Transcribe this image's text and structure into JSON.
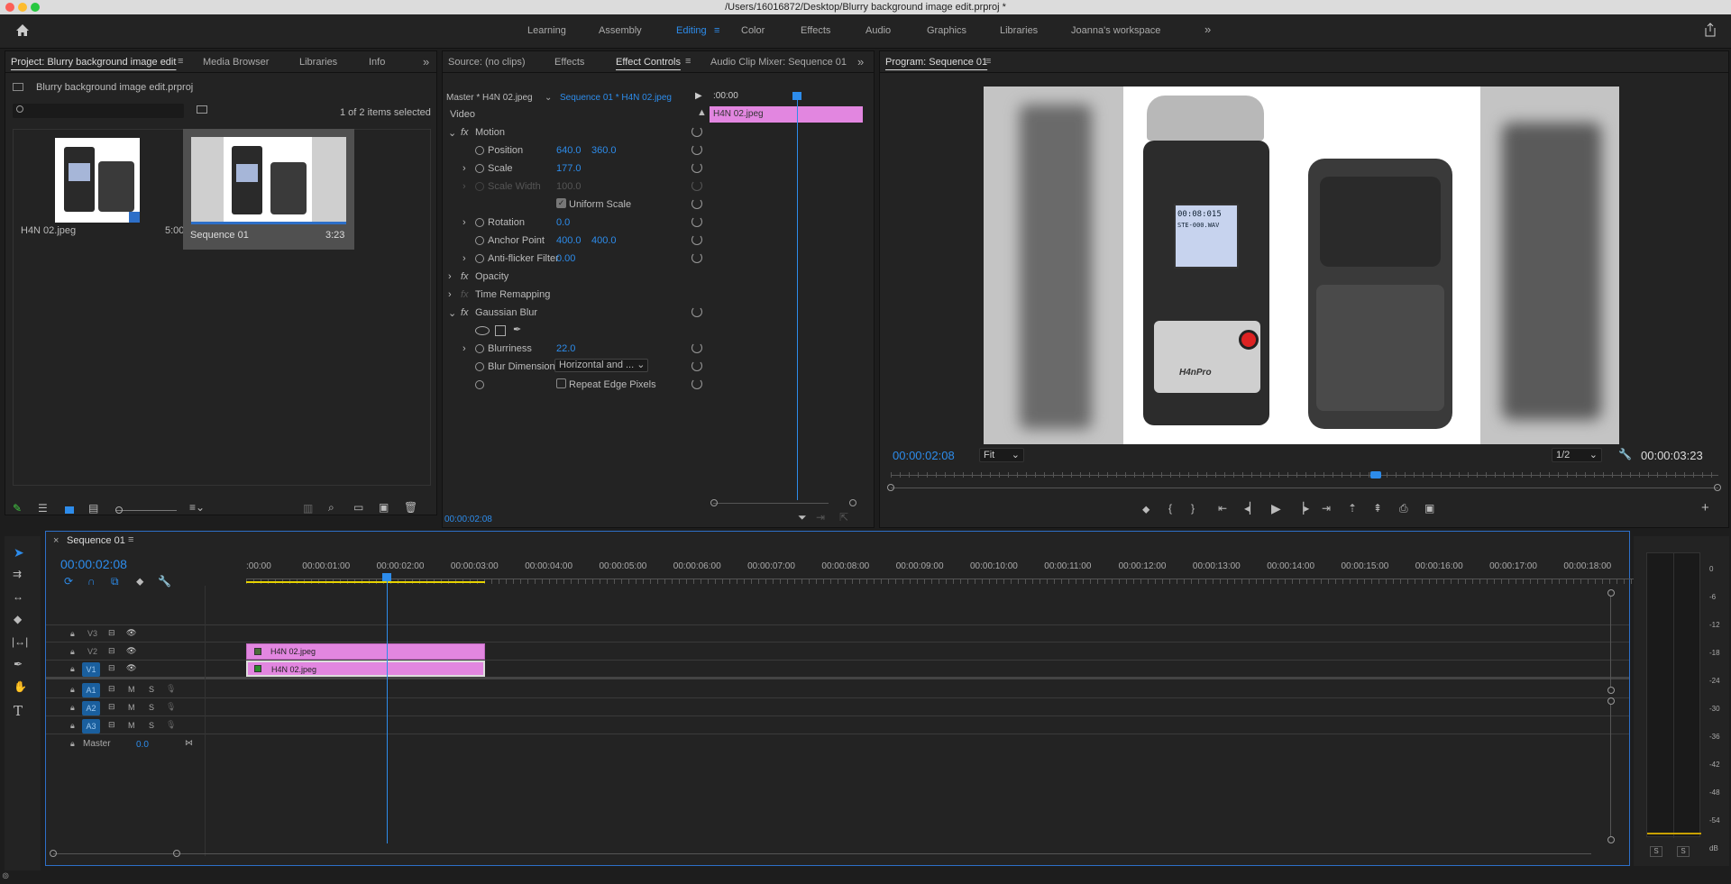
{
  "window": {
    "title": "/Users/16016872/Desktop/Blurry background image edit.prproj *"
  },
  "workspaces": [
    "Learning",
    "Assembly",
    "Editing",
    "Color",
    "Effects",
    "Audio",
    "Graphics",
    "Libraries",
    "Joanna's workspace"
  ],
  "active_workspace": "Editing",
  "project_panel": {
    "tabs": [
      "Project: Blurry background image edit",
      "Media Browser",
      "Libraries",
      "Info"
    ],
    "file": "Blurry background image edit.prproj",
    "selection": "1 of 2 items selected",
    "items": [
      {
        "name": "H4N 02.jpeg",
        "duration": "5:00"
      },
      {
        "name": "Sequence 01",
        "duration": "3:23"
      }
    ]
  },
  "effect_controls": {
    "tabs": [
      "Source: (no clips)",
      "Effects",
      "Effect Controls",
      "Audio Clip Mixer: Sequence 01"
    ],
    "master": "Master * H4N 02.jpeg",
    "sequence": "Sequence 01 * H4N 02.jpeg",
    "timecode_start": ":00:00",
    "clip_label": "H4N 02.jpeg",
    "section": "Video",
    "motion": "Motion",
    "position": "Position",
    "position_x": "640.0",
    "position_y": "360.0",
    "scale": "Scale",
    "scale_val": "177.0",
    "scale_width": "Scale Width",
    "scale_width_val": "100.0",
    "uniform_scale": "Uniform Scale",
    "rotation": "Rotation",
    "rotation_val": "0.0",
    "anchor": "Anchor Point",
    "anchor_x": "400.0",
    "anchor_y": "400.0",
    "antiflicker": "Anti-flicker Filter",
    "antiflicker_val": "0.00",
    "opacity": "Opacity",
    "time_remap": "Time Remapping",
    "blur": "Gaussian Blur",
    "blurriness": "Blurriness",
    "blurriness_val": "22.0",
    "blur_dim": "Blur Dimensions",
    "blur_dim_val": "Horizontal and ...",
    "repeat_edge": "Repeat Edge Pixels",
    "timecode": "00:00:02:08"
  },
  "program": {
    "tab": "Program: Sequence 01",
    "timecode": "00:00:02:08",
    "fit": "Fit",
    "resolution": "1/2",
    "duration": "00:00:03:23",
    "recorder_display": "00:08:015",
    "recorder_file": "STE-000.WAV",
    "recorder_brand": "H4nPro"
  },
  "timeline": {
    "tab": "Sequence 01",
    "timecode": "00:00:02:08",
    "ruler": [
      ":00:00",
      "00:00:01:00",
      "00:00:02:00",
      "00:00:03:00",
      "00:00:04:00",
      "00:00:05:00",
      "00:00:06:00",
      "00:00:07:00",
      "00:00:08:00",
      "00:00:09:00",
      "00:00:10:00",
      "00:00:11:00",
      "00:00:12:00",
      "00:00:13:00",
      "00:00:14:00",
      "00:00:15:00",
      "00:00:16:00",
      "00:00:17:00",
      "00:00:18:00"
    ],
    "video_tracks": [
      "V3",
      "V2",
      "V1"
    ],
    "audio_tracks": [
      "A1",
      "A2",
      "A3"
    ],
    "master": "Master",
    "master_val": "0.0",
    "clip_v2": "H4N 02.jpeg",
    "clip_v1": "H4N 02.jpeg"
  },
  "meters": {
    "scale": [
      "0",
      "-6",
      "-12",
      "-18",
      "-24",
      "-30",
      "-36",
      "-42",
      "-48",
      "-54",
      "dB"
    ],
    "solo": [
      "S",
      "S"
    ]
  }
}
